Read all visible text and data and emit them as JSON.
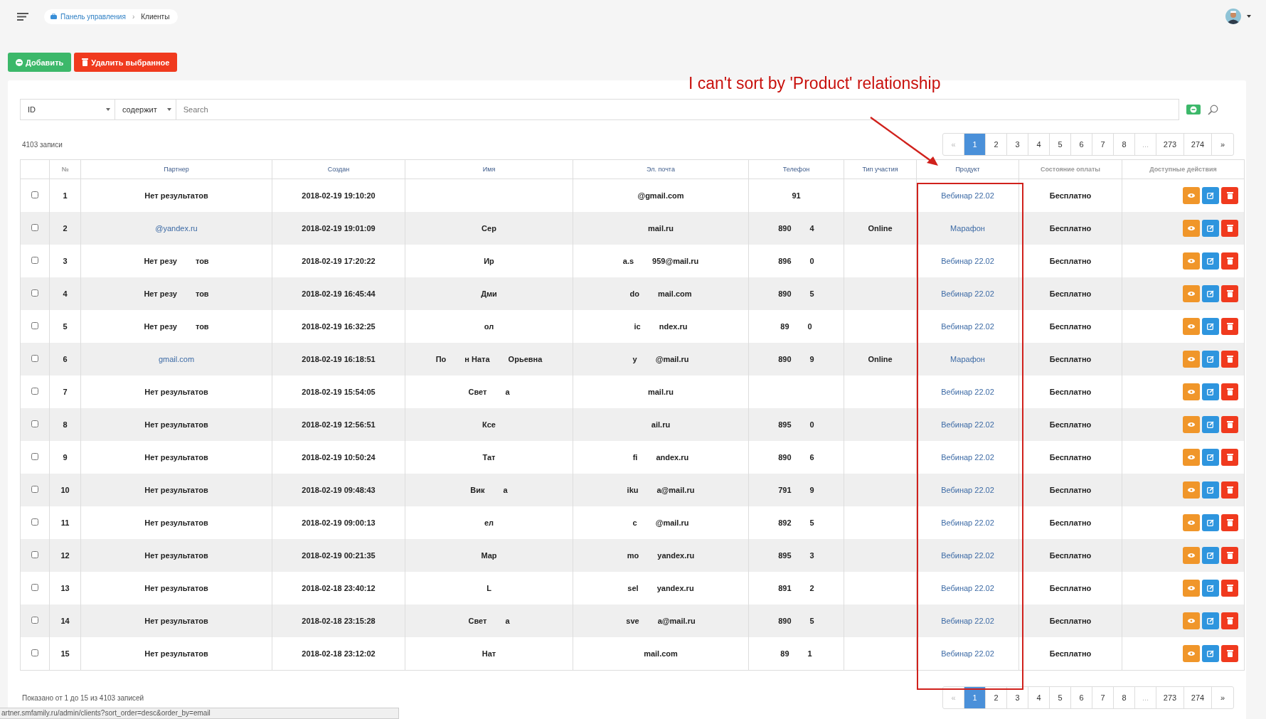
{
  "breadcrumb": [
    {
      "label": "Панель управления",
      "link": true
    },
    {
      "label": "Клиенты",
      "link": false
    }
  ],
  "breadcrumb_separator": "›",
  "actions": [
    {
      "label": "Добавить",
      "kind": "add"
    },
    {
      "label": "Удалить выбранное",
      "kind": "delete"
    }
  ],
  "filter": {
    "field": "ID",
    "operator": "содержит",
    "placeholder": "Search"
  },
  "record_count": "4103 записи",
  "pagination": [
    {
      "label": "«",
      "selected": false,
      "disabled": true
    },
    {
      "label": "1",
      "selected": true,
      "disabled": false
    },
    {
      "label": "2",
      "selected": false,
      "disabled": false
    },
    {
      "label": "3",
      "selected": false,
      "disabled": false
    },
    {
      "label": "4",
      "selected": false,
      "disabled": false
    },
    {
      "label": "5",
      "selected": false,
      "disabled": false
    },
    {
      "label": "6",
      "selected": false,
      "disabled": false
    },
    {
      "label": "7",
      "selected": false,
      "disabled": false
    },
    {
      "label": "8",
      "selected": false,
      "disabled": false
    },
    {
      "label": "...",
      "selected": false,
      "disabled": true
    },
    {
      "label": "273",
      "selected": false,
      "disabled": false
    },
    {
      "label": "274",
      "selected": false,
      "disabled": false
    },
    {
      "label": "»",
      "selected": false,
      "disabled": false
    }
  ],
  "table": {
    "columns": [
      {
        "label": "№",
        "sortable": false
      },
      {
        "label": "Партнер",
        "sortable": true
      },
      {
        "label": "Создан",
        "sortable": true
      },
      {
        "label": "Имя",
        "sortable": true
      },
      {
        "label": "Эл. почта",
        "sortable": true
      },
      {
        "label": "Телефон",
        "sortable": true
      },
      {
        "label": "Тип участия",
        "sortable": true
      },
      {
        "label": "Продукт",
        "sortable": true
      },
      {
        "label": "Состояние оплаты",
        "sortable": false
      },
      {
        "label": "Доступные действия",
        "sortable": false
      }
    ],
    "rows": [
      {
        "checked": false,
        "num": "1",
        "partner": {
          "kind": "text",
          "parts": [
            "Нет результатов"
          ]
        },
        "created": "2018-02-19 19:10:20",
        "email": [
          "@gmail.com"
        ],
        "phone": [
          "91"
        ],
        "product": "Вебинар 22.02",
        "payment": "Бесплатно"
      },
      {
        "checked": false,
        "num": "2",
        "partner": {
          "kind": "link",
          "parts": [
            "@yandex.ru"
          ]
        },
        "created": "2018-02-19 19:01:09",
        "name": [
          "Сер"
        ],
        "email": [
          "mail.ru"
        ],
        "phone": [
          "890",
          "4"
        ],
        "type": "Online",
        "product": "Марафон",
        "payment": "Бесплатно"
      },
      {
        "checked": false,
        "num": "3",
        "partner": {
          "kind": "text",
          "parts": [
            "Нет резу",
            "тов"
          ]
        },
        "created": "2018-02-19 17:20:22",
        "name": [
          "Ир"
        ],
        "email": [
          "a.s",
          "959@mail.ru"
        ],
        "phone": [
          "896",
          "0"
        ],
        "product": "Вебинар 22.02",
        "payment": "Бесплатно"
      },
      {
        "checked": false,
        "num": "4",
        "partner": {
          "kind": "text",
          "parts": [
            "Нет резу",
            "тов"
          ]
        },
        "created": "2018-02-19 16:45:44",
        "name": [
          "Дми"
        ],
        "email": [
          "do",
          "mail.com"
        ],
        "phone": [
          "890",
          "5"
        ],
        "product": "Вебинар 22.02",
        "payment": "Бесплатно"
      },
      {
        "checked": false,
        "num": "5",
        "partner": {
          "kind": "text",
          "parts": [
            "Нет резу",
            "тов"
          ]
        },
        "created": "2018-02-19 16:32:25",
        "name": [
          "ол"
        ],
        "email": [
          "ic",
          "ndex.ru"
        ],
        "phone": [
          "89",
          "0"
        ],
        "product": "Вебинар 22.02",
        "payment": "Бесплатно"
      },
      {
        "checked": false,
        "num": "6",
        "partner": {
          "kind": "link",
          "parts": [
            "gmail.com"
          ]
        },
        "created": "2018-02-19 16:18:51",
        "name": [
          "По",
          "н Ната",
          "Орьевна"
        ],
        "email": [
          "y",
          "@mail.ru"
        ],
        "phone": [
          "890",
          "9"
        ],
        "type": "Online",
        "product": "Марафон",
        "payment": "Бесплатно"
      },
      {
        "checked": false,
        "num": "7",
        "partner": {
          "kind": "text",
          "parts": [
            "Нет результатов"
          ]
        },
        "created": "2018-02-19 15:54:05",
        "name": [
          "Свет",
          "а"
        ],
        "email": [
          "mail.ru"
        ],
        "product": "Вебинар 22.02",
        "payment": "Бесплатно"
      },
      {
        "checked": false,
        "num": "8",
        "partner": {
          "kind": "text",
          "parts": [
            "Нет результатов"
          ]
        },
        "created": "2018-02-19 12:56:51",
        "name": [
          "Ксе"
        ],
        "email": [
          "ail.ru"
        ],
        "phone": [
          "895",
          "0"
        ],
        "product": "Вебинар 22.02",
        "payment": "Бесплатно"
      },
      {
        "checked": false,
        "num": "9",
        "partner": {
          "kind": "text",
          "parts": [
            "Нет результатов"
          ]
        },
        "created": "2018-02-19 10:50:24",
        "name": [
          "Тат"
        ],
        "email": [
          "fi",
          "andex.ru"
        ],
        "phone": [
          "890",
          "6"
        ],
        "product": "Вебинар 22.02",
        "payment": "Бесплатно"
      },
      {
        "checked": false,
        "num": "10",
        "partner": {
          "kind": "text",
          "parts": [
            "Нет результатов"
          ]
        },
        "created": "2018-02-19 09:48:43",
        "name": [
          "Вик",
          "а"
        ],
        "email": [
          "iku",
          "a@mail.ru"
        ],
        "phone": [
          "791",
          "9"
        ],
        "product": "Вебинар 22.02",
        "payment": "Бесплатно"
      },
      {
        "checked": false,
        "num": "11",
        "partner": {
          "kind": "text",
          "parts": [
            "Нет результатов"
          ]
        },
        "created": "2018-02-19 09:00:13",
        "name": [
          "ел"
        ],
        "email": [
          "c",
          "@mail.ru"
        ],
        "phone": [
          "892",
          "5"
        ],
        "product": "Вебинар 22.02",
        "payment": "Бесплатно"
      },
      {
        "checked": false,
        "num": "12",
        "partner": {
          "kind": "text",
          "parts": [
            "Нет результатов"
          ]
        },
        "created": "2018-02-19 00:21:35",
        "name": [
          "Мар"
        ],
        "email": [
          "mo",
          "yandex.ru"
        ],
        "phone": [
          "895",
          "3"
        ],
        "product": "Вебинар 22.02",
        "payment": "Бесплатно"
      },
      {
        "checked": false,
        "num": "13",
        "partner": {
          "kind": "text",
          "parts": [
            "Нет результатов"
          ]
        },
        "created": "2018-02-18 23:40:12",
        "name": [
          "L"
        ],
        "email": [
          "sel",
          "yandex.ru"
        ],
        "phone": [
          "891",
          "2"
        ],
        "product": "Вебинар 22.02",
        "payment": "Бесплатно"
      },
      {
        "checked": false,
        "num": "14",
        "partner": {
          "kind": "text",
          "parts": [
            "Нет результатов"
          ]
        },
        "created": "2018-02-18 23:15:28",
        "name": [
          "Свет",
          "а"
        ],
        "email": [
          "sve",
          "a@mail.ru"
        ],
        "phone": [
          "890",
          "5"
        ],
        "product": "Вебинар 22.02",
        "payment": "Бесплатно"
      },
      {
        "checked": false,
        "num": "15",
        "partner": {
          "kind": "text",
          "parts": [
            "Нет результатов"
          ]
        },
        "created": "2018-02-18 23:12:02",
        "name": [
          "Нат"
        ],
        "email": [
          "mail.com"
        ],
        "phone": [
          "89",
          "1"
        ],
        "product": "Вебинар 22.02",
        "payment": "Бесплатно"
      }
    ]
  },
  "summary": "Показано от 1 до 15 из 4103 записей",
  "pagination_bottom": [
    {
      "label": "«",
      "selected": false,
      "disabled": true
    },
    {
      "label": "1",
      "selected": true,
      "disabled": false
    },
    {
      "label": "2",
      "selected": false,
      "disabled": false
    },
    {
      "label": "3",
      "selected": false,
      "disabled": false
    },
    {
      "label": "4",
      "selected": false,
      "disabled": false
    },
    {
      "label": "5",
      "selected": false,
      "disabled": false
    },
    {
      "label": "6",
      "selected": false,
      "disabled": false
    },
    {
      "label": "7",
      "selected": false,
      "disabled": false
    },
    {
      "label": "8",
      "selected": false,
      "disabled": false
    },
    {
      "label": "...",
      "selected": false,
      "disabled": true
    },
    {
      "label": "273",
      "selected": false,
      "disabled": false
    },
    {
      "label": "274",
      "selected": false,
      "disabled": false
    },
    {
      "label": "»",
      "selected": false,
      "disabled": false
    }
  ],
  "status_bar": {
    "url": "artner.smfamily.ru/admin/clients?sort_order=desc&order_by=email"
  },
  "annotation": {
    "text": "I can't sort by 'Product' relationship"
  }
}
